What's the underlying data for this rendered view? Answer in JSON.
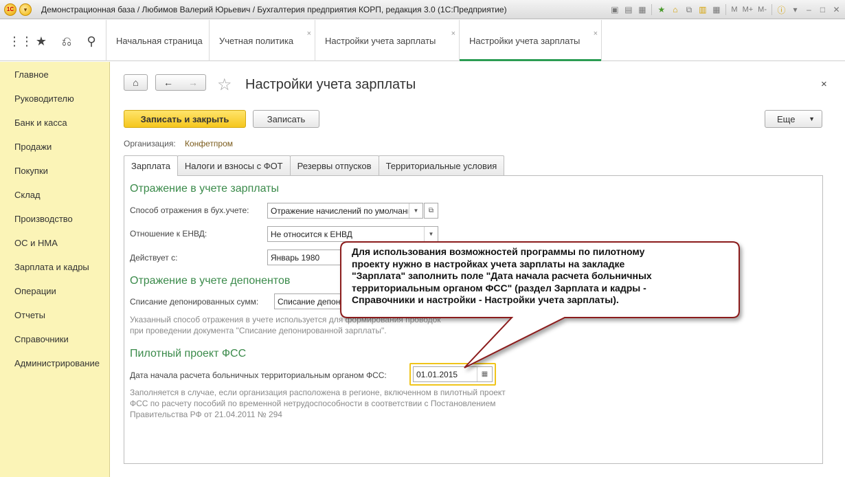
{
  "titlebar": {
    "title": "Демонстрационная база / Любимов Валерий Юрьевич / Бухгалтерия предприятия КОРП, редакция 3.0  (1С:Предприятие)",
    "logo_text": "1С",
    "mem_labels": [
      "M",
      "M+",
      "M-"
    ]
  },
  "open_tabs": [
    {
      "label": "Начальная страница"
    },
    {
      "label": "Учетная политика"
    },
    {
      "label": "Настройки учета зарплаты"
    },
    {
      "label": "Настройки учета зарплаты"
    }
  ],
  "tab_close_glyph": "×",
  "sidebar": {
    "items": [
      "Главное",
      "Руководителю",
      "Банк и касса",
      "Продажи",
      "Покупки",
      "Склад",
      "Производство",
      "ОС и НМА",
      "Зарплата и кадры",
      "Операции",
      "Отчеты",
      "Справочники",
      "Администрирование"
    ]
  },
  "form": {
    "title": "Настройки учета зарплаты",
    "close_glyph": "×",
    "save_close_label": "Записать и закрыть",
    "save_label": "Записать",
    "more_label": "Еще",
    "org_label": "Организация:",
    "org_value": "Конфетпром",
    "tabs": [
      "Зарплата",
      "Налоги и взносы с ФОТ",
      "Резервы отпусков",
      "Территориальные условия"
    ],
    "section1": {
      "title": "Отражение в учете зарплаты",
      "method_label": "Способ отражения в бух.учете:",
      "method_value": "Отражение начислений по умолчанию",
      "envd_label": "Отношение к ЕНВД:",
      "envd_value": "Не относится к ЕНВД",
      "valid_label": "Действует с:",
      "valid_value": "Январь 1980"
    },
    "section2": {
      "title": "Отражение в учете депонентов",
      "writeoff_label": "Списание депонированных сумм:",
      "writeoff_value": "Списание депонированной зарплаты",
      "hint_line1": "Указанный способ отражения в учете используется для формирования проводок",
      "hint_line2": "при проведении документа \"Списание депонированной зарплаты\"."
    },
    "section3": {
      "title": "Пилотный проект ФСС",
      "date_label": "Дата начала расчета больничных территориальным органом ФСС:",
      "date_value": "01.01.2015",
      "hint_line1": "Заполняется в случае, если организация расположена в регионе, включенном в пилотный проект",
      "hint_line2": "ФСС по расчету пособий по временной нетрудоспособности в соответствии с Постановлением",
      "hint_line3": "Правительства РФ от 21.04.2011 № 294"
    }
  },
  "callout": {
    "text": "Для использования возможностей программы по пилотному\nпроекту нужно  в настройках учета зарплаты на закладке\n\"Зарплата\" заполнить поле \"Дата начала расчета больничных\nтерриториальным органом ФСС\" (раздел Зарплата и кадры -\nСправочники и настройки - Настройки учета зарплаты)."
  },
  "colors": {
    "accent_green": "#3a8a4a",
    "sidebar_bg": "#fbf4b7",
    "primary_button": "#f5c61d",
    "callout_border": "#8b1a1a"
  }
}
